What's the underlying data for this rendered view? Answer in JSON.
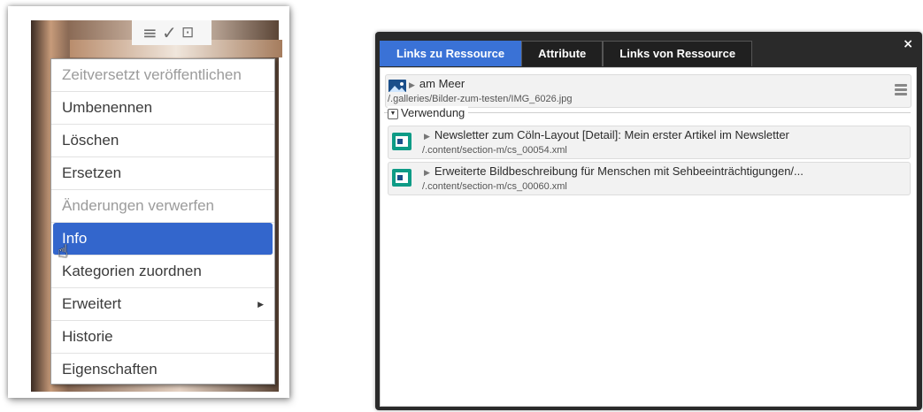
{
  "context_menu": {
    "toolbar_icons": [
      "list-icon",
      "check-icon",
      "search-doc-icon"
    ],
    "items": [
      {
        "label": "Zeitversetzt veröffentlichen",
        "disabled": true
      },
      {
        "label": "Umbenennen",
        "disabled": false
      },
      {
        "label": "Löschen",
        "disabled": false
      },
      {
        "label": "Ersetzen",
        "disabled": false
      },
      {
        "label": "Änderungen verwerfen",
        "disabled": true
      },
      {
        "label": "Info",
        "active": true
      },
      {
        "label": "Kategorien zuordnen",
        "disabled": false
      },
      {
        "label": "Erweitert",
        "has_submenu": true
      },
      {
        "label": "Historie",
        "disabled": false
      },
      {
        "label": "Eigenschaften",
        "disabled": false
      }
    ],
    "accent_color": "#3366cc"
  },
  "dialog": {
    "tabs": [
      {
        "label": "Links zu Ressource",
        "active": true
      },
      {
        "label": "Attribute",
        "active": false
      },
      {
        "label": "Links von Ressource",
        "active": false
      }
    ],
    "close_label": "×",
    "resource": {
      "title": "am Meer",
      "path": "/.galleries/Bilder-zum-testen/IMG_6026.jpg"
    },
    "usage_legend": "Verwendung",
    "usages": [
      {
        "title": "Newsletter zum Cöln-Layout [Detail]: Mein erster Artikel im Newsletter",
        "path": "/.content/section-m/cs_00054.xml"
      },
      {
        "title": "Erweiterte Bildbeschreibung für Menschen mit Sehbeeinträchtigungen/...",
        "path": "/.content/section-m/cs_00060.xml"
      }
    ],
    "accent_color": "#3a72d6"
  }
}
